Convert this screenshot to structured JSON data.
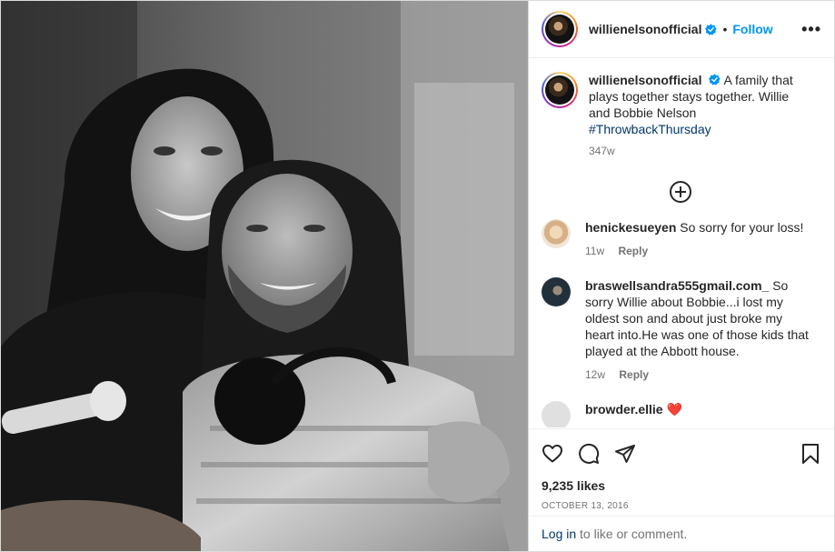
{
  "post": {
    "username": "willienelsonofficial",
    "follow_label": "Follow",
    "more_label": "•••",
    "dot": "•",
    "caption": {
      "username": "willienelsonofficial",
      "text": "A family that plays together stays together. Willie and Bobbie Nelson",
      "hashtag": "#ThrowbackThursday",
      "time": "347w"
    },
    "comments": [
      {
        "username": "henickesueyen",
        "text": "So sorry for your loss!",
        "time": "11w",
        "reply_label": "Reply"
      },
      {
        "username": "braswellsandra555gmail.com_",
        "text": "So sorry Willie about Bobbie...i lost my oldest son and about just broke my heart into.He was one of those kids that played at the Abbott house.",
        "time": "12w",
        "reply_label": "Reply"
      },
      {
        "username": "browder.ellie",
        "text": "❤️"
      }
    ],
    "likes": "9,235 likes",
    "date": "OCTOBER 13, 2016",
    "footer": {
      "login": "Log in",
      "rest": " to like or comment."
    }
  },
  "colors": {
    "accent": "#0095f6",
    "link": "#00376b",
    "muted": "#737373"
  },
  "icons": [
    "verified-icon",
    "more-icon",
    "load-more-icon",
    "heart-icon",
    "comment-icon",
    "share-icon",
    "bookmark-icon"
  ]
}
